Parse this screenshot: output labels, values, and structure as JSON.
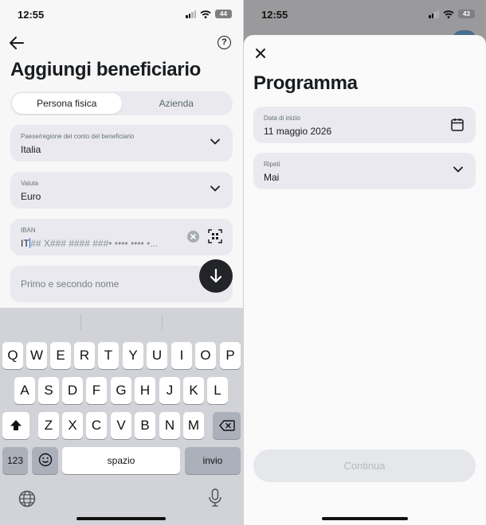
{
  "left": {
    "status": {
      "time": "12:55",
      "battery": "44"
    },
    "title": "Aggiungi beneficiario",
    "segments": [
      {
        "label": "Persona fisica",
        "active": true
      },
      {
        "label": "Azienda",
        "active": false
      }
    ],
    "country": {
      "label": "Paese/regione del conto del beneficiario",
      "value": "Italia"
    },
    "currency": {
      "label": "Valuta",
      "value": "Euro"
    },
    "iban": {
      "label": "IBAN",
      "typed": "IT",
      "mask": "## X### #### ###• •••• •••• •..."
    },
    "name_field": {
      "placeholder": "Primo e secondo nome"
    },
    "icons": {
      "back": "arrow-left-icon",
      "help": "question-mark-icon",
      "scan": "scan-iban-icon",
      "clear": "clear-icon",
      "fab": "arrow-down-icon"
    },
    "help_glyph": "?"
  },
  "keyboard": {
    "row1": [
      "Q",
      "W",
      "E",
      "R",
      "T",
      "Y",
      "U",
      "I",
      "O",
      "P"
    ],
    "row2": [
      "A",
      "S",
      "D",
      "F",
      "G",
      "H",
      "J",
      "K",
      "L"
    ],
    "row3": [
      "Z",
      "X",
      "C",
      "V",
      "B",
      "N",
      "M"
    ],
    "numbers": "123",
    "space": "spazio",
    "return": "invio",
    "icons": {
      "shift": "shift-icon",
      "delete": "backspace-icon",
      "emoji": "emoji-icon",
      "globe": "globe-icon",
      "mic": "microphone-icon"
    }
  },
  "right": {
    "status": {
      "time": "12:55",
      "battery": "43"
    },
    "title": "Programma",
    "start_date": {
      "label": "Data di inizio",
      "value": "11 maggio 2026"
    },
    "repeat": {
      "label": "Ripeti",
      "value": "Mai"
    },
    "continue_label": "Continua",
    "icons": {
      "close": "close-icon",
      "calendar": "calendar-icon"
    }
  },
  "colors": {
    "accent_caret": "#2f6fed",
    "field_bg": "#e9e9ef",
    "fab_bg": "#222427"
  }
}
